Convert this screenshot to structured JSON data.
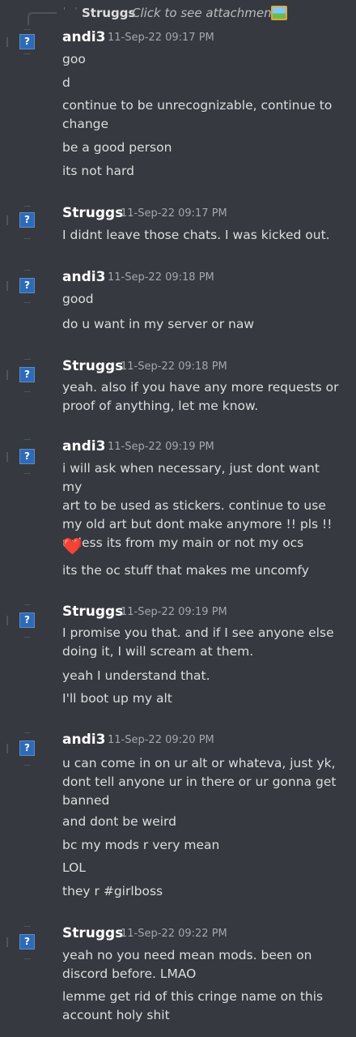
{
  "reply": {
    "author": "Struggs",
    "link_text": "Click to see attachment",
    "icon": "image-attachment-icon"
  },
  "avatar_glyph": "?",
  "messages": [
    {
      "author": "andi3",
      "timestamp": "11-Sep-22 09:17 PM",
      "lines": [
        "goo",
        "d",
        "continue to be unrecognizable, continue to\nchange",
        "be a good person",
        "its not hard"
      ]
    },
    {
      "author": "Struggs",
      "timestamp": "11-Sep-22 09:17 PM",
      "lines": [
        "I didnt leave those chats. I was kicked out."
      ]
    },
    {
      "author": "andi3",
      "timestamp": "11-Sep-22 09:18 PM",
      "lines": [
        "good",
        "do u want in my server or naw"
      ]
    },
    {
      "author": "Struggs",
      "timestamp": "11-Sep-22 09:18 PM",
      "lines": [
        "yeah. also if you have any more requests or\nproof of anything, let me know."
      ]
    },
    {
      "author": "andi3",
      "timestamp": "11-Sep-22 09:19 PM",
      "lines": [
        "i will ask when necessary, just dont want my\nart to be used as stickers. continue to use\nmy old art but dont make anymore !! pls !!\nunless its from my main or not my ocs",
        "its the oc stuff that makes me uncomfy"
      ],
      "emoji": "❤️"
    },
    {
      "author": "Struggs",
      "timestamp": "11-Sep-22 09:19 PM",
      "lines": [
        "I promise you that. and if I see anyone else\ndoing it, I will scream at them.",
        "yeah I understand that.",
        "I'll boot up my alt"
      ]
    },
    {
      "author": "andi3",
      "timestamp": "11-Sep-22 09:20 PM",
      "lines": [
        "u can come in on ur alt or whateva, just yk,\ndont tell anyone ur in there or ur gonna get\nbanned",
        "and dont be weird",
        "bc my mods r very mean",
        "LOL",
        "they r #girlboss"
      ]
    },
    {
      "author": "Struggs",
      "timestamp": "11-Sep-22 09:22 PM",
      "lines": [
        "yeah no you need mean mods. been on\ndiscord before. LMAO",
        "lemme get rid of this cringe name on this\naccount holy shit"
      ]
    }
  ]
}
